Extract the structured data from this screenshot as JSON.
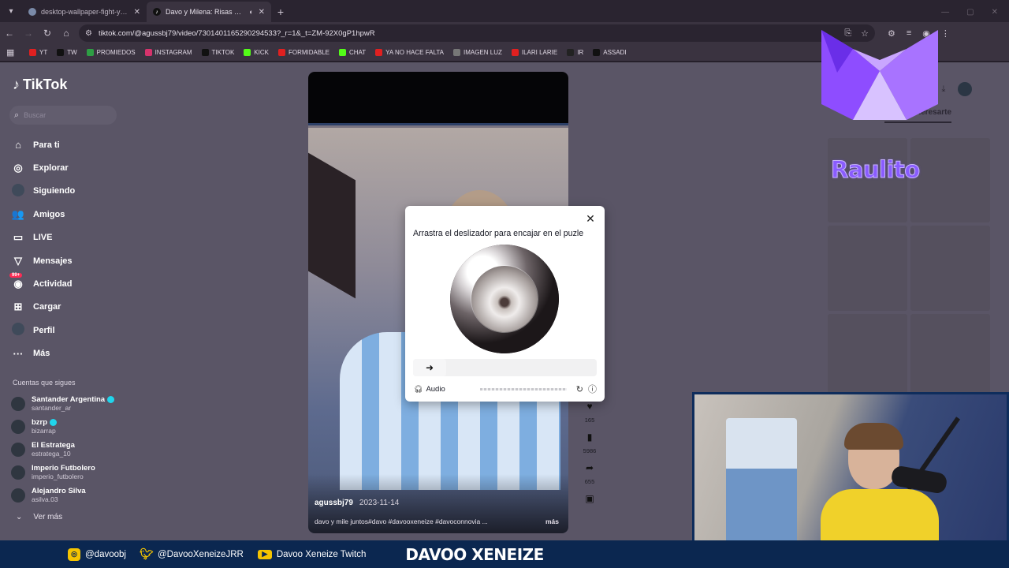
{
  "browser": {
    "tabs": [
      {
        "title": "desktop-wallpaper-fight-yellow",
        "active": false
      },
      {
        "title": "Davo y Milena: Risas en el C",
        "active": true
      }
    ],
    "url": "tiktok.com/@agussbj79/video/7301401165290294533?_r=1&_t=ZM-92X0gP1hpwR",
    "bookmarks": [
      {
        "label": "YT",
        "color": "#e02020"
      },
      {
        "label": "TW",
        "color": "#111111"
      },
      {
        "label": "PROMIEDOS",
        "color": "#2e9e44"
      },
      {
        "label": "INSTAGRAM",
        "color": "#d6336c"
      },
      {
        "label": "TIKTOK",
        "color": "#111111"
      },
      {
        "label": "KICK",
        "color": "#53fc18"
      },
      {
        "label": "FORMIDABLE",
        "color": "#e02020"
      },
      {
        "label": "CHAT",
        "color": "#53fc18"
      },
      {
        "label": "YA NO HACE FALTA",
        "color": "#e02020"
      },
      {
        "label": "IMAGEN LUZ",
        "color": "#777777"
      },
      {
        "label": "ILARI LARIE",
        "color": "#e02020"
      },
      {
        "label": "IR",
        "color": "#222222"
      },
      {
        "label": "ASSADI",
        "color": "#111111"
      }
    ]
  },
  "tiktok": {
    "logo": "TikTok",
    "search_placeholder": "Buscar",
    "menu": [
      {
        "label": "Para ti",
        "icon": "home-icon",
        "glyph": "⌂"
      },
      {
        "label": "Explorar",
        "icon": "compass-icon",
        "glyph": "◎"
      },
      {
        "label": "Siguiendo",
        "icon": "following-avatar-icon",
        "glyph": ""
      },
      {
        "label": "Amigos",
        "icon": "friends-icon",
        "glyph": "👥"
      },
      {
        "label": "LIVE",
        "icon": "live-icon",
        "glyph": "▭"
      },
      {
        "label": "Mensajes",
        "icon": "messages-icon",
        "glyph": "▽"
      },
      {
        "label": "Actividad",
        "icon": "activity-icon",
        "glyph": "◉",
        "badge": "99+"
      },
      {
        "label": "Cargar",
        "icon": "upload-icon",
        "glyph": "⊞"
      },
      {
        "label": "Perfil",
        "icon": "profile-avatar-icon",
        "glyph": ""
      },
      {
        "label": "Más",
        "icon": "more-icon",
        "glyph": "···"
      }
    ],
    "following_title": "Cuentas que sigues",
    "following": [
      {
        "name": "Santander Argentina",
        "handle": "santander_ar",
        "verified": true
      },
      {
        "name": "bzrp",
        "handle": "bizarrap",
        "verified": true
      },
      {
        "name": "El Estratega",
        "handle": "estratega_10",
        "verified": false
      },
      {
        "name": "Imperio Futbolero",
        "handle": "imperio_futbolero",
        "verified": false
      },
      {
        "name": "Alejandro Silva",
        "handle": "asilva.03",
        "verified": false
      }
    ],
    "see_more": "Ver más",
    "video": {
      "author": "agussbj79",
      "date": "2023-11-14",
      "description": "davo y mile juntos#davo #davooxeneize #davoconnovia ...",
      "more": "más"
    },
    "actions": [
      {
        "icon": "like-icon",
        "glyph": "♥",
        "count": "165"
      },
      {
        "icon": "bookmark-icon",
        "glyph": "▮",
        "count": "5986"
      },
      {
        "icon": "share-icon",
        "glyph": "➦",
        "count": "655"
      },
      {
        "icon": "embed-icon",
        "glyph": "▣",
        "count": ""
      }
    ],
    "right_tab_active": "Podría interesarte"
  },
  "captcha": {
    "title": "Arrastra el deslizador para encajar en el puzle",
    "audio_label": "Audio",
    "slider_position": 0
  },
  "stream": {
    "links": [
      {
        "icon": "instagram-icon",
        "label": "@davoobj"
      },
      {
        "icon": "twitter-icon",
        "label": "@DavooXeneizeJRR"
      },
      {
        "icon": "youtube-icon",
        "label": "Davoo Xeneize Twitch"
      }
    ],
    "brand": "DAVOO XENEIZE",
    "overlay_name": "Raulito",
    "accent": "#f5c400",
    "bar_color": "#0b2750"
  }
}
